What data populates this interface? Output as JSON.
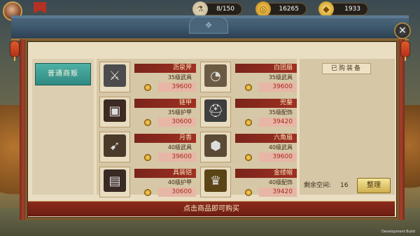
{
  "resources": [
    {
      "icon": "flask-icon",
      "value": "8/150"
    },
    {
      "icon": "copper-coin-icon",
      "value": "16265"
    },
    {
      "icon": "gold-ingot-icon",
      "value": "1933"
    }
  ],
  "tab": {
    "label": "普通商贩"
  },
  "items": [
    {
      "name": "沥泉斧",
      "sub": "35级武具",
      "price": "39600",
      "icon": "axe-icon"
    },
    {
      "name": "白团扇",
      "sub": "35级武具",
      "price": "39600",
      "icon": "fan-icon"
    },
    {
      "name": "链甲",
      "sub": "35级护甲",
      "price": "30600",
      "icon": "chainmail-icon"
    },
    {
      "name": "兜鍪",
      "sub": "35级配饰",
      "price": "39420",
      "icon": "helmet-icon"
    },
    {
      "name": "月香",
      "sub": "40级武具",
      "price": "39600",
      "icon": "bow-icon"
    },
    {
      "name": "六角扇",
      "sub": "40级武具",
      "price": "39600",
      "icon": "hex-fan-icon"
    },
    {
      "name": "具装铠",
      "sub": "40级护甲",
      "price": "30600",
      "icon": "armor-icon"
    },
    {
      "name": "金缕帽",
      "sub": "40级配饰",
      "price": "39420",
      "icon": "gold-helmet-icon"
    }
  ],
  "owned": {
    "title": "已购装备",
    "space_label": "剩余空间:",
    "space_value": "16",
    "arrange_button": "整理"
  },
  "footer": {
    "hint": "点击商品即可购买"
  },
  "dev_label": "Development Build"
}
